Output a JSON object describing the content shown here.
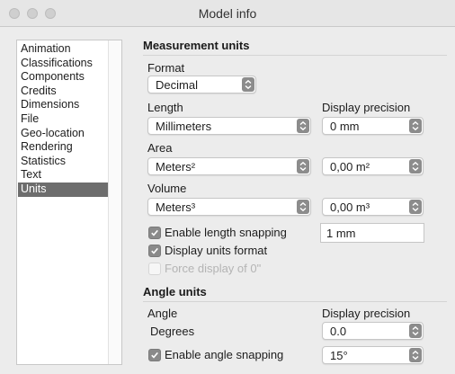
{
  "window": {
    "title": "Model info"
  },
  "sidebar": {
    "items": [
      {
        "label": "Animation",
        "selected": false
      },
      {
        "label": "Classifications",
        "selected": false
      },
      {
        "label": "Components",
        "selected": false
      },
      {
        "label": "Credits",
        "selected": false
      },
      {
        "label": "Dimensions",
        "selected": false
      },
      {
        "label": "File",
        "selected": false
      },
      {
        "label": "Geo-location",
        "selected": false
      },
      {
        "label": "Rendering",
        "selected": false
      },
      {
        "label": "Statistics",
        "selected": false
      },
      {
        "label": "Text",
        "selected": false
      },
      {
        "label": "Units",
        "selected": true
      }
    ]
  },
  "measurement": {
    "title": "Measurement units",
    "format": {
      "label": "Format",
      "value": "Decimal"
    },
    "length": {
      "label": "Length",
      "value": "Millimeters"
    },
    "display_precision_label": "Display precision",
    "length_precision": "0 mm",
    "area": {
      "label": "Area",
      "value": "Meters²",
      "precision": "0,00 m²"
    },
    "volume": {
      "label": "Volume",
      "value": "Meters³",
      "precision": "0,00 m³"
    },
    "length_snapping": {
      "label": "Enable length snapping",
      "checked": true,
      "value": "1 mm"
    },
    "display_units_format": {
      "label": "Display units format",
      "checked": true
    },
    "force_display_zero": {
      "label": "Force display of 0\"",
      "checked": false,
      "enabled": false
    }
  },
  "angle": {
    "title": "Angle units",
    "angle_label": "Angle",
    "display_precision_label": "Display precision",
    "angle_value": "Degrees",
    "precision": "0.0",
    "angle_snapping": {
      "label": "Enable angle snapping",
      "checked": true,
      "value": "15°"
    }
  },
  "colors": {
    "selection": "#6d6d6d",
    "checkbox_checked": "#8a8a8a",
    "stepper": "#8c8c8c",
    "window_bg": "#ececec"
  },
  "icons": [
    "traffic-light-close",
    "traffic-light-minimize",
    "traffic-light-maximize",
    "up-down-chevron-icon",
    "checkmark-icon"
  ]
}
